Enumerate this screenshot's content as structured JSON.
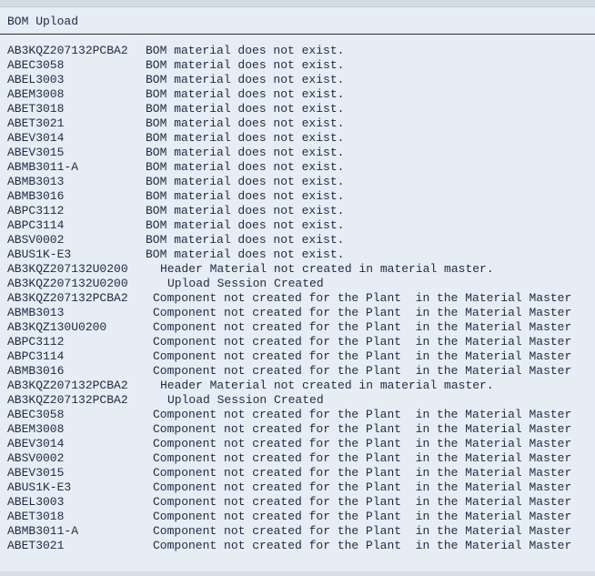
{
  "report": {
    "title": "BOM Upload"
  },
  "rows": [
    {
      "material": "AB3KQZ207132PCBA2",
      "message": "BOM material does not exist.",
      "kind": "bom"
    },
    {
      "material": "ABEC3058",
      "message": "BOM material does not exist.",
      "kind": "bom"
    },
    {
      "material": "ABEL3003",
      "message": "BOM material does not exist.",
      "kind": "bom"
    },
    {
      "material": "ABEM3008",
      "message": "BOM material does not exist.",
      "kind": "bom"
    },
    {
      "material": "ABET3018",
      "message": "BOM material does not exist.",
      "kind": "bom"
    },
    {
      "material": "ABET3021",
      "message": "BOM material does not exist.",
      "kind": "bom"
    },
    {
      "material": "ABEV3014",
      "message": "BOM material does not exist.",
      "kind": "bom"
    },
    {
      "material": "ABEV3015",
      "message": "BOM material does not exist.",
      "kind": "bom"
    },
    {
      "material": "ABMB3011-A",
      "message": "BOM material does not exist.",
      "kind": "bom"
    },
    {
      "material": "ABMB3013",
      "message": "BOM material does not exist.",
      "kind": "bom"
    },
    {
      "material": "ABMB3016",
      "message": "BOM material does not exist.",
      "kind": "bom"
    },
    {
      "material": "ABPC3112",
      "message": "BOM material does not exist.",
      "kind": "bom"
    },
    {
      "material": "ABPC3114",
      "message": "BOM material does not exist.",
      "kind": "bom"
    },
    {
      "material": "ABSV0002",
      "message": "BOM material does not exist.",
      "kind": "bom"
    },
    {
      "material": "ABUS1K-E3",
      "message": "BOM material does not exist.",
      "kind": "bom"
    },
    {
      "material": "AB3KQZ207132U0200",
      "message": "Header Material not created in material master.",
      "kind": "hdr"
    },
    {
      "material": "AB3KQZ207132U0200",
      "message": "Upload Session Created",
      "kind": "upl"
    },
    {
      "material": "AB3KQZ207132PCBA2",
      "message": "Component not created for the Plant  in the Material Master",
      "kind": "cmp"
    },
    {
      "material": "ABMB3013",
      "message": "Component not created for the Plant  in the Material Master",
      "kind": "cmp"
    },
    {
      "material": "AB3KQZ130U0200",
      "message": "Component not created for the Plant  in the Material Master",
      "kind": "cmp"
    },
    {
      "material": "ABPC3112",
      "message": "Component not created for the Plant  in the Material Master",
      "kind": "cmp"
    },
    {
      "material": "ABPC3114",
      "message": "Component not created for the Plant  in the Material Master",
      "kind": "cmp"
    },
    {
      "material": "ABMB3016",
      "message": "Component not created for the Plant  in the Material Master",
      "kind": "cmp"
    },
    {
      "material": "AB3KQZ207132PCBA2",
      "message": "Header Material not created in material master.",
      "kind": "hdr"
    },
    {
      "material": "AB3KQZ207132PCBA2",
      "message": "Upload Session Created",
      "kind": "upl"
    },
    {
      "material": "ABEC3058",
      "message": "Component not created for the Plant  in the Material Master",
      "kind": "cmp"
    },
    {
      "material": "ABEM3008",
      "message": "Component not created for the Plant  in the Material Master",
      "kind": "cmp"
    },
    {
      "material": "ABEV3014",
      "message": "Component not created for the Plant  in the Material Master",
      "kind": "cmp"
    },
    {
      "material": "ABSV0002",
      "message": "Component not created for the Plant  in the Material Master",
      "kind": "cmp"
    },
    {
      "material": "ABEV3015",
      "message": "Component not created for the Plant  in the Material Master",
      "kind": "cmp"
    },
    {
      "material": "ABUS1K-E3",
      "message": "Component not created for the Plant  in the Material Master",
      "kind": "cmp"
    },
    {
      "material": "ABEL3003",
      "message": "Component not created for the Plant  in the Material Master",
      "kind": "cmp"
    },
    {
      "material": "ABET3018",
      "message": "Component not created for the Plant  in the Material Master",
      "kind": "cmp"
    },
    {
      "material": "ABMB3011-A",
      "message": "Component not created for the Plant  in the Material Master",
      "kind": "cmp"
    },
    {
      "material": "ABET3021",
      "message": "Component not created for the Plant  in the Material Master",
      "kind": "cmp"
    }
  ]
}
